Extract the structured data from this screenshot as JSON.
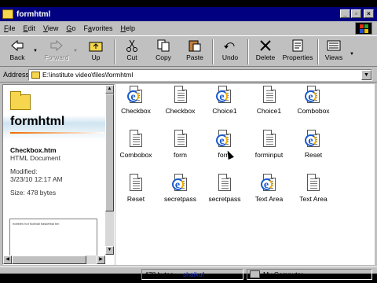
{
  "window": {
    "title": "formhtml"
  },
  "menu": [
    {
      "pre": "",
      "u": "F",
      "post": "ile"
    },
    {
      "pre": "",
      "u": "E",
      "post": "dit"
    },
    {
      "pre": "",
      "u": "V",
      "post": "iew"
    },
    {
      "pre": "",
      "u": "G",
      "post": "o"
    },
    {
      "pre": "F",
      "u": "a",
      "post": "vorites"
    },
    {
      "pre": "",
      "u": "H",
      "post": "elp"
    }
  ],
  "toolbar": {
    "back": "Back",
    "forward": "Forward",
    "up": "Up",
    "cut": "Cut",
    "copy": "Copy",
    "paste": "Paste",
    "undo": "Undo",
    "delete": "Delete",
    "properties": "Properties",
    "views": "Views"
  },
  "address": {
    "label": "Address",
    "value": "E:\\institute video\\files\\formhtml"
  },
  "left_pane": {
    "folder_name": "formhtml",
    "file_name": "Checkbox.htm",
    "file_type": "HTML Document",
    "modified_label": "Modified:",
    "modified_value": "3/23/10 12:17 AM",
    "size": "Size: 478 bytes",
    "preview_text": "hobbies hot football basketbal bin"
  },
  "files": [
    {
      "name": "Checkbox",
      "icon": "ie-icon"
    },
    {
      "name": "Checkbox",
      "icon": "document-icon"
    },
    {
      "name": "Choice1",
      "icon": "ie-icon"
    },
    {
      "name": "Choice1",
      "icon": "document-icon"
    },
    {
      "name": "Combobox",
      "icon": "ie-icon"
    },
    {
      "name": "Combobox",
      "icon": "document-icon"
    },
    {
      "name": "form",
      "icon": "document-icon"
    },
    {
      "name": "form",
      "icon": "ie-icon"
    },
    {
      "name": "forminput",
      "icon": "document-icon"
    },
    {
      "name": "Reset",
      "icon": "ie-icon"
    },
    {
      "name": "Reset",
      "icon": "document-icon"
    },
    {
      "name": "secretpass",
      "icon": "ie-icon"
    },
    {
      "name": "secretpass",
      "icon": "document-icon"
    },
    {
      "name": "Text Area",
      "icon": "ie-icon"
    },
    {
      "name": "Text Area",
      "icon": "document-icon"
    }
  ],
  "status": {
    "size": "478 bytes",
    "user": "shaikof",
    "location": "My Computer"
  }
}
